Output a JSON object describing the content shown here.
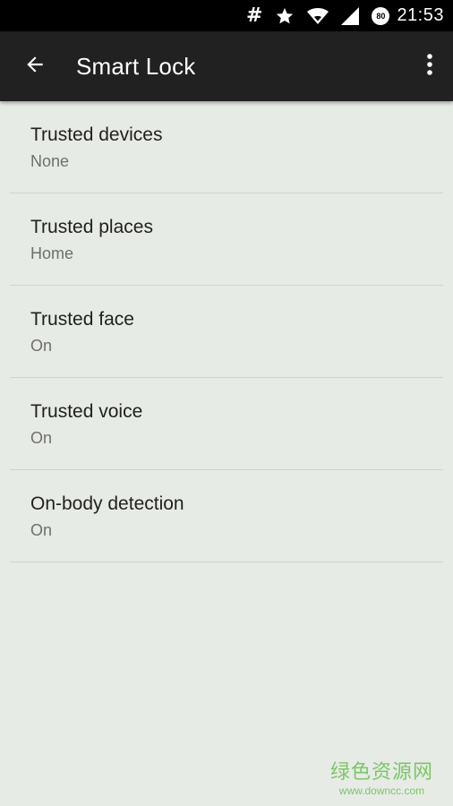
{
  "status_bar": {
    "icons": [
      "hash-icon",
      "star-icon",
      "wifi-icon",
      "signal-icon",
      "data-saver-icon"
    ],
    "hash_glyph": "#",
    "badge_text": "80",
    "time": "21:53"
  },
  "app_bar": {
    "title": "Smart Lock",
    "back_icon": "arrow-back-icon",
    "overflow_icon": "more-vert-icon"
  },
  "settings": {
    "items": [
      {
        "title": "Trusted devices",
        "summary": "None"
      },
      {
        "title": "Trusted places",
        "summary": "Home"
      },
      {
        "title": "Trusted face",
        "summary": "On"
      },
      {
        "title": "Trusted voice",
        "summary": "On"
      },
      {
        "title": "On-body detection",
        "summary": "On"
      }
    ]
  },
  "watermark": {
    "main": "绿色资源网",
    "url": "www.downcc.com"
  },
  "colors": {
    "background": "#e7ebe5",
    "app_bar": "#212121",
    "status_bar": "#000000",
    "watermark": "#7dc56a"
  }
}
